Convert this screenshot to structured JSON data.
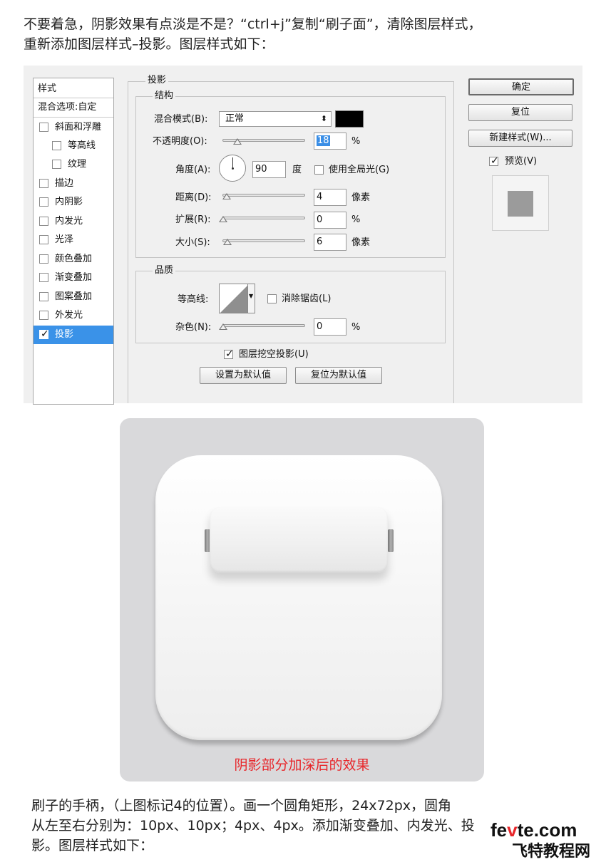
{
  "intro": {
    "line1": "不要着急，阴影效果有点淡是不是？“ctrl+j”复制“刷子面”，清除图层样式，",
    "line2": "重新添加图层样式–投影。图层样式如下："
  },
  "dialog": {
    "sidebar": {
      "title": "样式",
      "blend": "混合选项:自定",
      "items": [
        {
          "label": "斜面和浮雕",
          "checked": false
        },
        {
          "label": "等高线",
          "checked": false
        },
        {
          "label": "纹理",
          "checked": false
        },
        {
          "label": "描边",
          "checked": false
        },
        {
          "label": "内阴影",
          "checked": false
        },
        {
          "label": "内发光",
          "checked": false
        },
        {
          "label": "光泽",
          "checked": false
        },
        {
          "label": "颜色叠加",
          "checked": false
        },
        {
          "label": "渐变叠加",
          "checked": false
        },
        {
          "label": "图案叠加",
          "checked": false
        },
        {
          "label": "外发光",
          "checked": false
        },
        {
          "label": "投影",
          "checked": true
        }
      ]
    },
    "section_title": "投影",
    "structure": {
      "title": "结构",
      "blend_mode_label": "混合模式(B):",
      "blend_mode_value": "正常",
      "opacity_label": "不透明度(O):",
      "opacity_value": "18",
      "opacity_unit": "%",
      "angle_label": "角度(A):",
      "angle_value": "90",
      "angle_unit": "度",
      "global_light_label": "使用全局光(G)",
      "distance_label": "距离(D):",
      "distance_value": "4",
      "distance_unit": "像素",
      "spread_label": "扩展(R):",
      "spread_value": "0",
      "spread_unit": "%",
      "size_label": "大小(S):",
      "size_value": "6",
      "size_unit": "像素",
      "shadow_color": "#000000"
    },
    "quality": {
      "title": "品质",
      "contour_label": "等高线:",
      "antialias_label": "消除锯齿(L)",
      "noise_label": "杂色(N):",
      "noise_value": "0",
      "noise_unit": "%"
    },
    "knockout_label": "图层挖空投影(U)",
    "make_default": "设置为默认值",
    "reset_default": "复位为默认值",
    "ok": "确定",
    "reset": "复位",
    "new_style": "新建样式(W)...",
    "preview_label": "预览(V)"
  },
  "illustration": {
    "caption": "阴影部分加深后的效果",
    "caption_color": "#e8262a"
  },
  "outro": {
    "line1": "刷子的手柄，（上图标记4的位置）。画一个圆角矩形，24x72px，圆角",
    "line2": "从左至右分别为：10px、10px；4px、4px。添加渐变叠加、内发光、投",
    "line3": "影。图层样式如下："
  },
  "watermark": {
    "top_a": "fe",
    "top_v": "v",
    "top_b": "te.com",
    "bottom": "飞特教程网"
  }
}
